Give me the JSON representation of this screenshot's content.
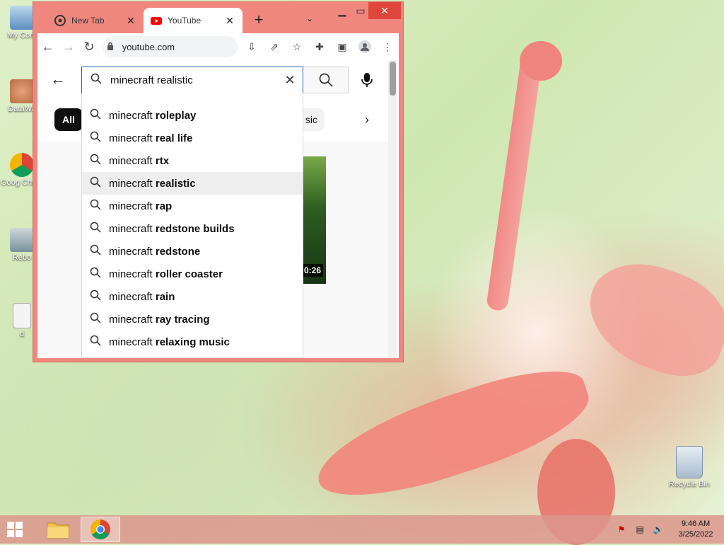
{
  "desktop": {
    "icons": [
      {
        "label": "My Com"
      },
      {
        "label": "DataWa"
      },
      {
        "label": "Goog Chron"
      },
      {
        "label": "Rebo"
      },
      {
        "label": "d"
      }
    ],
    "recycle_bin": "Recycle Bin"
  },
  "browser": {
    "tabs": [
      {
        "title": "New Tab",
        "favicon": "chrome-icon"
      },
      {
        "title": "YouTube",
        "favicon": "youtube-icon"
      }
    ],
    "address": "youtube.com"
  },
  "youtube": {
    "search_value": "minecraft realistic",
    "chip_all": "All",
    "chip_partial": "sic",
    "video_duration": "0:26",
    "suggestions": [
      {
        "prefix": "minecraft ",
        "bold": "roleplay"
      },
      {
        "prefix": "minecraft ",
        "bold": "real life"
      },
      {
        "prefix": "minecraft ",
        "bold": "rtx"
      },
      {
        "prefix": "minecraft ",
        "bold": "realistic"
      },
      {
        "prefix": "minecraft ",
        "bold": "rap"
      },
      {
        "prefix": "minecraft ",
        "bold": "redstone builds"
      },
      {
        "prefix": "minecraft ",
        "bold": "redstone"
      },
      {
        "prefix": "minecraft ",
        "bold": "roller coaster"
      },
      {
        "prefix": "minecraft ",
        "bold": "rain"
      },
      {
        "prefix": "minecraft ",
        "bold": "ray tracing"
      },
      {
        "prefix": "minecraft ",
        "bold": "relaxing music"
      }
    ]
  },
  "taskbar": {
    "time": "9:46 AM",
    "date": "3/25/2022"
  },
  "colors": {
    "accent": "#1c62b9",
    "window_frame": "#f0877f",
    "close_button": "#e0463b"
  }
}
